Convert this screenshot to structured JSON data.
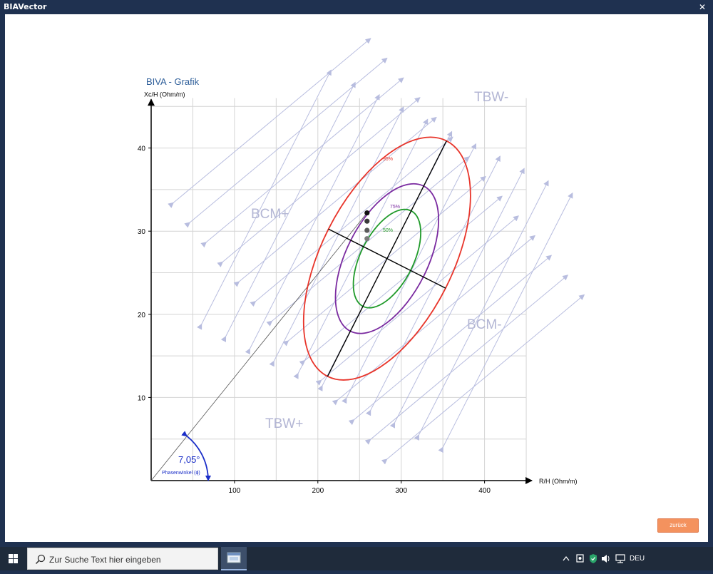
{
  "window": {
    "title": "BIAVector",
    "close_glyph": "✕"
  },
  "chart_data": {
    "type": "scatter",
    "title": "BIVA - Grafik",
    "xlabel": "R/H (Ohm/m)",
    "ylabel": "Xc/H (Ohm/m)",
    "xlim": [
      0,
      450
    ],
    "ylim": [
      0,
      45
    ],
    "xticks": [
      100,
      200,
      300,
      400
    ],
    "yticks": [
      10,
      20,
      30,
      40
    ],
    "grid": true,
    "quadrant_labels": [
      "TBW-",
      "BCM+",
      "BCM-",
      "TBW+"
    ],
    "tolerance_ellipses": [
      {
        "label": "95%",
        "color": "#e8342a"
      },
      {
        "label": "75%",
        "color": "#7a2aa0"
      },
      {
        "label": "50%",
        "color": "#1f9a2a"
      }
    ],
    "points": [
      {
        "x": 259,
        "y": 32.2,
        "color": "#111111"
      },
      {
        "x": 259,
        "y": 31.2,
        "color": "#3a3a3a"
      },
      {
        "x": 259,
        "y": 30.1,
        "color": "#5a5a5a"
      },
      {
        "x": 259,
        "y": 29.1,
        "color": "#7a7a7a"
      }
    ],
    "phase_angle": {
      "value": "7,05°",
      "label": "Phasenwinkel (ϕ)"
    }
  },
  "buttons": {
    "back_label": "zurück"
  },
  "taskbar": {
    "search_placeholder": "Zur Suche Text hier eingeben",
    "language": "DEU"
  }
}
